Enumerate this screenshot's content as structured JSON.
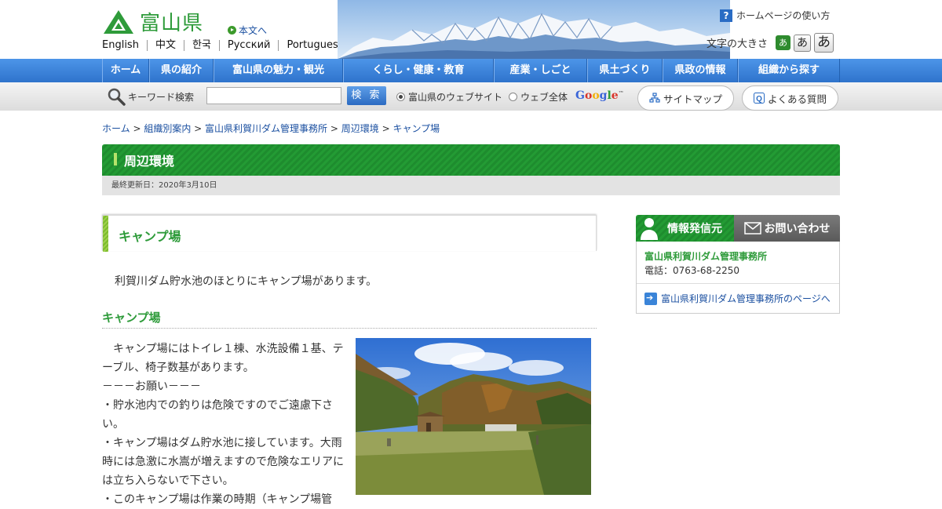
{
  "header": {
    "logo_text": "富山県",
    "skip_link": "本文へ",
    "languages": [
      "English",
      "中文",
      "한국",
      "Русский",
      "Portugues"
    ],
    "help_link": "ホームページの使い方",
    "font_size_label": "文字の大きさ",
    "font_size_buttons": [
      "あ",
      "あ",
      "あ"
    ]
  },
  "nav": {
    "items": [
      "ホーム",
      "県の紹介",
      "富山県の魅力・観光",
      "くらし・健康・教育",
      "産業・しごと",
      "県土づくり",
      "県政の情報",
      "組織から探す"
    ]
  },
  "search": {
    "label": "キーワード検索",
    "input_value": "",
    "button": "検 索",
    "radio_site": "富山県のウェブサイト",
    "radio_web": "ウェブ全体",
    "google": "Google",
    "google_tm": "™",
    "sitemap": "サイトマップ",
    "faq": "よくある質問"
  },
  "breadcrumb": {
    "items": [
      "ホーム",
      "組織別案内",
      "富山県利賀川ダム管理事務所",
      "周辺環境",
      "キャンプ場"
    ],
    "separator": " > "
  },
  "page": {
    "title": "周辺環境",
    "updated": "最終更新日：2020年3月10日",
    "heading": "キャンプ場",
    "intro": "利賀川ダム貯水池のほとりにキャンプ場があります。",
    "subheading": "キャンプ場",
    "paragraphs": [
      "　キャンプ場にはトイレ１棟、水洗設備１基、テーブル、椅子数基があります。",
      "－－－お願い－－－",
      "・貯水池内での釣りは危険ですのでご遠慮下さい。",
      "・キャンプ場はダム貯水池に接しています。大雨時には急激に水嵩が増えますので危険なエリアには立ち入らないで下さい。",
      "・このキャンプ場は作業の時期（キャンプ場管"
    ]
  },
  "sidebar": {
    "tab_source": "情報発信元",
    "tab_contact": "お問い合わせ",
    "org_name": "富山県利賀川ダム管理事務所",
    "phone": "電話：0763-68-2250",
    "org_link": "富山県利賀川ダム管理事務所のページへ"
  },
  "colors": {
    "green": "#2e9b3a",
    "nav_blue": "#3a80d8",
    "link": "#1a4fa0"
  }
}
